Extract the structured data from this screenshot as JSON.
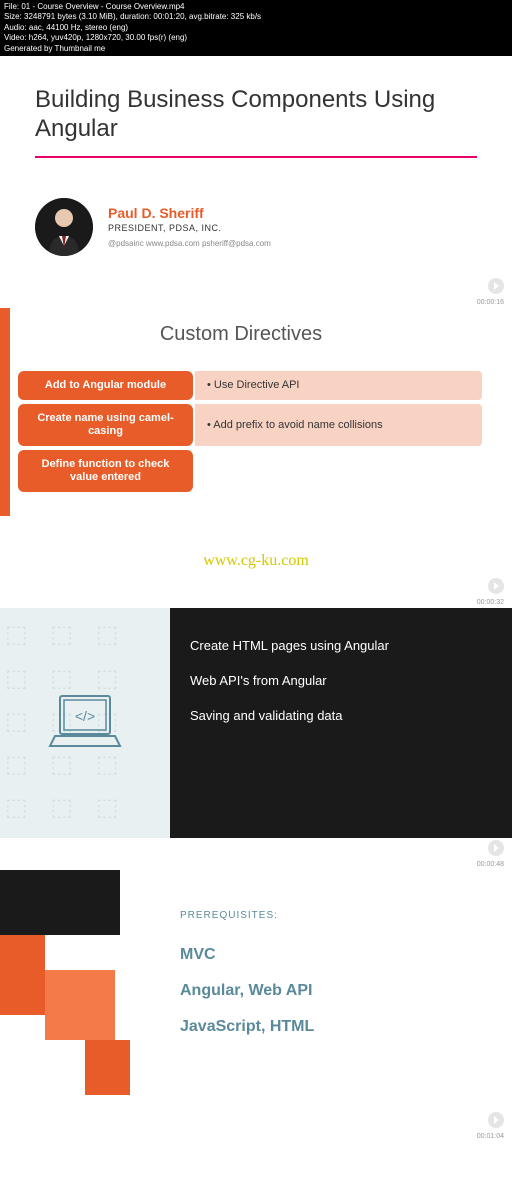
{
  "metadata": {
    "file": "File: 01 - Course Overview - Course Overview.mp4",
    "size": "Size: 3248791 bytes (3.10 MiB), duration: 00:01:20, avg.bitrate: 325 kb/s",
    "audio": "Audio: aac, 44100 Hz, stereo (eng)",
    "video": "Video: h264, yuv420p, 1280x720, 30.00 fps(r) (eng)",
    "generated": "Generated by Thumbnail me"
  },
  "slide1": {
    "title": "Building Business Components Using Angular",
    "author_name": "Paul D. Sheriff",
    "author_title": "PRESIDENT, PDSA, INC.",
    "author_contact": "@pdsainc   www.pdsa.com   psheriff@pdsa.com",
    "timestamp": "00:00:16"
  },
  "slide2": {
    "title": "Custom Directives",
    "rows": [
      {
        "left": "Add to Angular module",
        "right": "• Use Directive API"
      },
      {
        "left": "Create name using camel-casing",
        "right": "• Add prefix to avoid name collisions"
      },
      {
        "left": "Define function to check value entered",
        "right": ""
      }
    ],
    "timestamp": "00:00:32"
  },
  "watermark": "www.cg-ku.com",
  "slide3": {
    "lines": [
      "Create HTML pages using Angular",
      "Web API's from Angular",
      "Saving and validating data"
    ],
    "timestamp": "00:00:48"
  },
  "slide4": {
    "label": "PREREQUISITES:",
    "items": [
      "MVC",
      "Angular, Web API",
      "JavaScript, HTML"
    ],
    "timestamp": "00:01:04"
  }
}
